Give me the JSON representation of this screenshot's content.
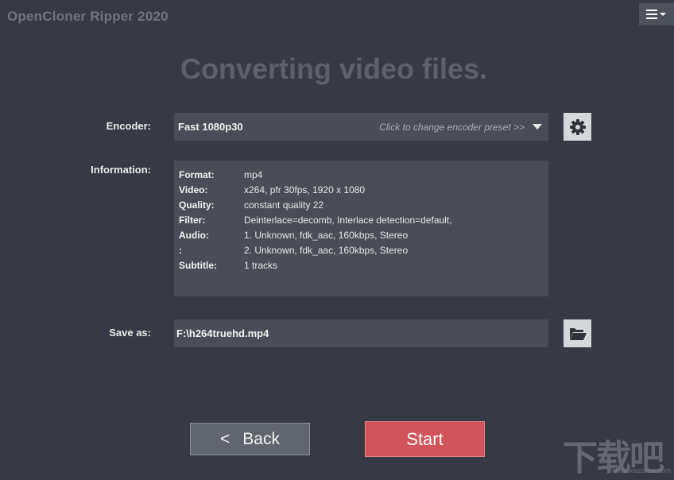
{
  "app": {
    "title": "OpenCloner Ripper 2020",
    "menu_icon": "hamburger-menu-icon"
  },
  "heading": "Converting video files.",
  "encoder": {
    "label": "Encoder:",
    "value": "Fast 1080p30",
    "hint": "Click to change encoder preset >>",
    "dropdown_icon": "caret-down-icon",
    "settings_icon": "gear-icon"
  },
  "information": {
    "label": "Information:",
    "rows": [
      {
        "key": "Format:",
        "value": "mp4"
      },
      {
        "key": "Video:",
        "value": "x264, pfr 30fps, 1920 x 1080"
      },
      {
        "key": "Quality:",
        "value": "constant quality 22"
      },
      {
        "key": "Filter:",
        "value": "Deinterlace=decomb, Interlace detection=default,"
      },
      {
        "key": "Audio:",
        "value": "1. Unknown, fdk_aac, 160kbps, Stereo"
      },
      {
        "key": ":",
        "value": "2. Unknown, fdk_aac, 160kbps, Stereo"
      },
      {
        "key": "Subtitle:",
        "value": "1 tracks"
      }
    ]
  },
  "save_as": {
    "label": "Save as:",
    "value": "F:\\h264truehd.mp4",
    "browse_icon": "folder-open-icon"
  },
  "buttons": {
    "back_chevron": "<",
    "back": "Back",
    "start": "Start"
  },
  "watermark": {
    "text": "下载吧",
    "url": "www.xiazaiba.com"
  },
  "colors": {
    "background": "#373a44",
    "panel": "#4a4d57",
    "start_accent": "#d0545a",
    "back_button": "#61656f"
  }
}
